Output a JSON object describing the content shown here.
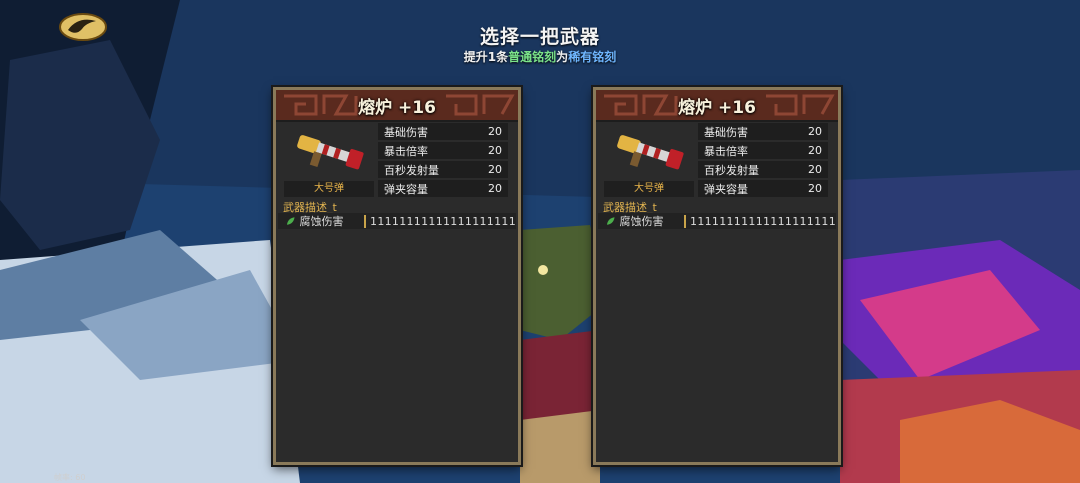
{
  "header": {
    "title": "选择一把武器",
    "subtitle_parts": [
      {
        "text": "提升1条",
        "color": "#f0f0f0"
      },
      {
        "text": "普通铭刻",
        "color": "#7be38a"
      },
      {
        "text": "为",
        "color": "#f0f0f0"
      },
      {
        "text": "稀有铭刻",
        "color": "#6fb6ff"
      }
    ]
  },
  "cards": [
    {
      "name": "熔炉 +16",
      "ammo_type": "大号弹",
      "stats": [
        {
          "label": "基础伤害",
          "value": "20"
        },
        {
          "label": "暴击倍率",
          "value": "20"
        },
        {
          "label": "百秒发射量",
          "value": "20"
        },
        {
          "label": "弹夹容量",
          "value": "20"
        }
      ],
      "description": "武器描述_t",
      "effect": {
        "icon": "leaf-icon",
        "name": "腐蚀伤害",
        "value": "11111111111111111111"
      }
    },
    {
      "name": "熔炉 +16",
      "ammo_type": "大号弹",
      "stats": [
        {
          "label": "基础伤害",
          "value": "20"
        },
        {
          "label": "暴击倍率",
          "value": "20"
        },
        {
          "label": "百秒发射量",
          "value": "20"
        },
        {
          "label": "弹夹容量",
          "value": "20"
        }
      ],
      "description": "武器描述_t",
      "effect": {
        "icon": "leaf-icon",
        "name": "腐蚀伤害",
        "value": "11111111111111111111"
      }
    }
  ],
  "hud": {
    "fps_text": "帧率: 60"
  },
  "colors": {
    "ammo": "#e8b44a",
    "description": "#e2b450",
    "common": "#7be38a",
    "rare": "#6fb6ff"
  }
}
